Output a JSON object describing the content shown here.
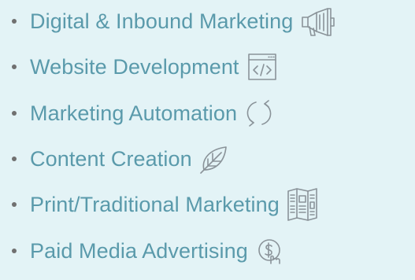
{
  "services": {
    "items": [
      {
        "label": "Digital & Inbound Marketing",
        "icon": "megaphone-icon"
      },
      {
        "label": "Website Development",
        "icon": "code-window-icon"
      },
      {
        "label": "Marketing Automation",
        "icon": "refresh-arrows-icon"
      },
      {
        "label": "Content Creation",
        "icon": "leaf-icon"
      },
      {
        "label": "Print/Traditional Marketing",
        "icon": "brochure-icon"
      },
      {
        "label": "Paid Media Advertising",
        "icon": "hand-coin-icon"
      }
    ]
  },
  "colors": {
    "background": "#e3f3f6",
    "text": "#5a9aab",
    "bullet": "#707070",
    "icon": "#8a9399"
  }
}
